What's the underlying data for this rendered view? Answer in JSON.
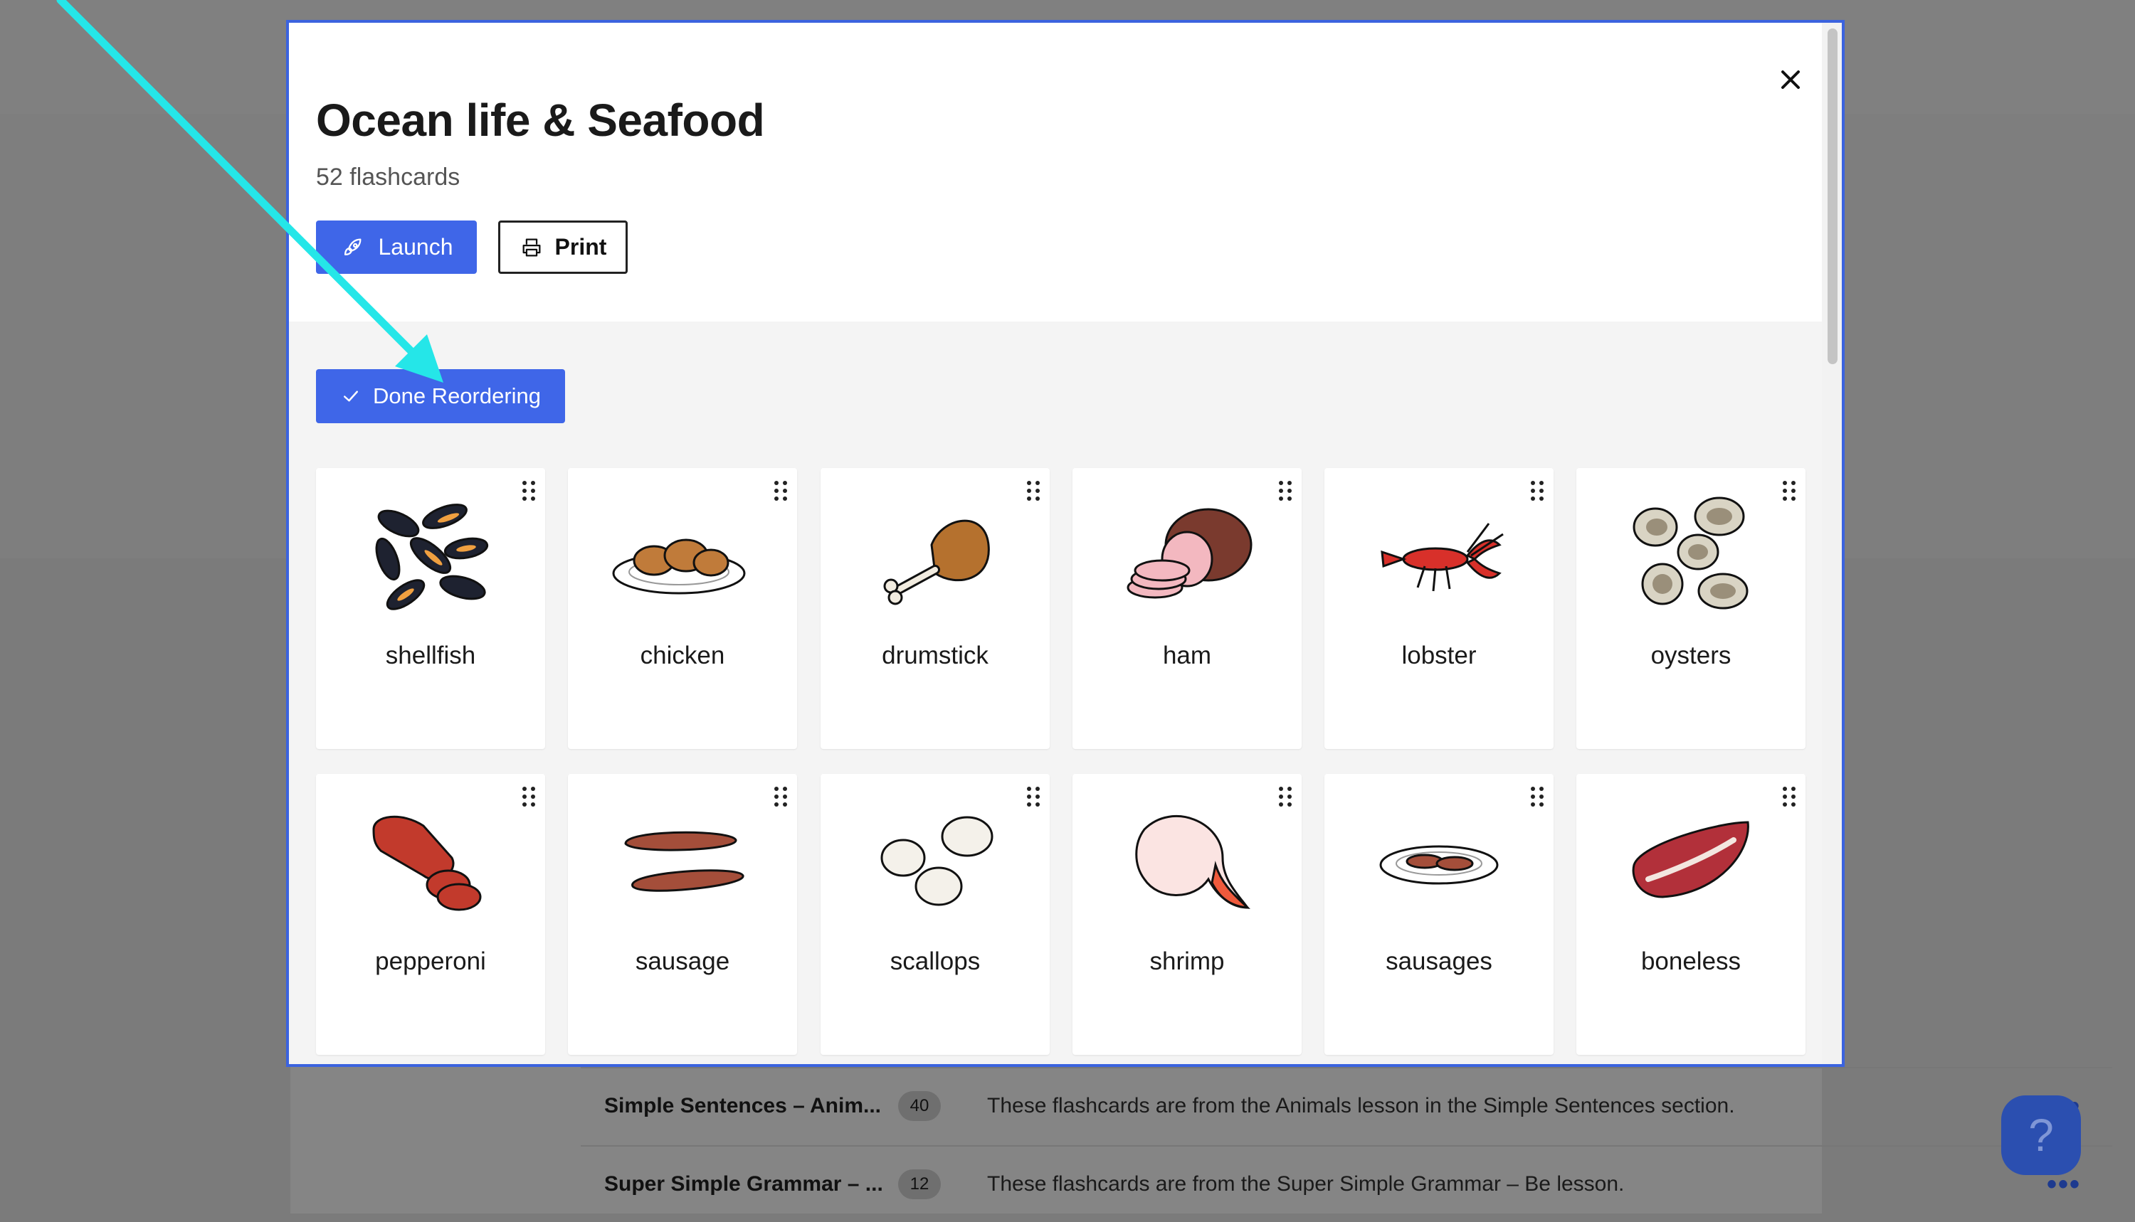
{
  "background": {
    "rows": [
      {
        "title": "Simple Sentences – Anim...",
        "count": "40",
        "description": "These flashcards are from the Animals lesson in the Simple Sentences section."
      },
      {
        "title": "Super Simple Grammar – ...",
        "count": "12",
        "description": "These flashcards are from the Super Simple Grammar – Be lesson."
      }
    ],
    "more_label": "•••",
    "help_label": "?"
  },
  "modal": {
    "title": "Ocean life & Seafood",
    "subtitle": "52 flashcards",
    "launch_label": "Launch",
    "print_label": "Print",
    "done_label": "Done Reordering",
    "cards": [
      {
        "label": "shellfish",
        "icon": "mussels-icon"
      },
      {
        "label": "chicken",
        "icon": "chicken-plate-icon"
      },
      {
        "label": "drumstick",
        "icon": "drumstick-icon"
      },
      {
        "label": "ham",
        "icon": "ham-icon"
      },
      {
        "label": "lobster",
        "icon": "lobster-icon"
      },
      {
        "label": "oysters",
        "icon": "oysters-icon"
      },
      {
        "label": "pepperoni",
        "icon": "pepperoni-icon"
      },
      {
        "label": "sausage",
        "icon": "sausage-icon"
      },
      {
        "label": "scallops",
        "icon": "scallops-icon"
      },
      {
        "label": "shrimp",
        "icon": "shrimp-icon"
      },
      {
        "label": "sausages",
        "icon": "sausages-plate-icon"
      },
      {
        "label": "boneless",
        "icon": "boneless-meat-icon"
      }
    ]
  },
  "colors": {
    "accent": "#3f66e8",
    "annotation_arrow": "#25e6e8"
  }
}
